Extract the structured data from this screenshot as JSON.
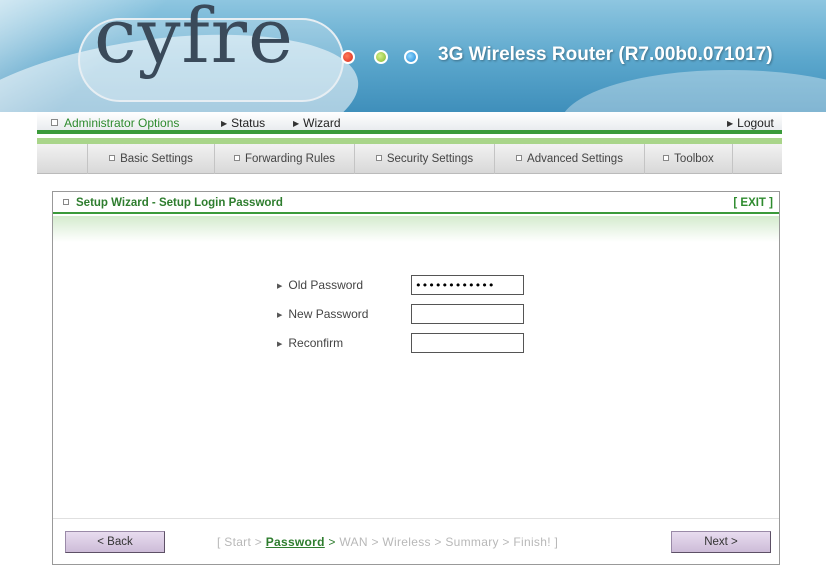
{
  "header": {
    "logo_text": "cyfre",
    "router_title": "3G Wireless Router (R7.00b0.071017)"
  },
  "topnav": {
    "admin": "Administrator Options",
    "status": "Status",
    "wizard": "Wizard",
    "logout": "Logout"
  },
  "tabs": [
    {
      "label": "Basic Settings"
    },
    {
      "label": "Forwarding Rules"
    },
    {
      "label": "Security Settings"
    },
    {
      "label": "Advanced Settings"
    },
    {
      "label": "Toolbox"
    }
  ],
  "panel": {
    "title": "Setup Wizard - Setup Login Password",
    "exit": "[ EXIT ]"
  },
  "form": {
    "old_password": {
      "label": "Old Password",
      "value": "••••••••••••"
    },
    "new_password": {
      "label": "New Password",
      "value": ""
    },
    "reconfirm": {
      "label": "Reconfirm",
      "value": ""
    }
  },
  "footer": {
    "back": "< Back",
    "next": "Next >",
    "steps": {
      "open": "[ Start > ",
      "current": "Password",
      "arrow": " > ",
      "rest": "WAN > Wireless > Summary > Finish! ]"
    }
  },
  "colors": {
    "accent_green": "#3a9a3a",
    "header_blue": "#5aa6cc",
    "button_lavender": "#cdbcd8"
  }
}
